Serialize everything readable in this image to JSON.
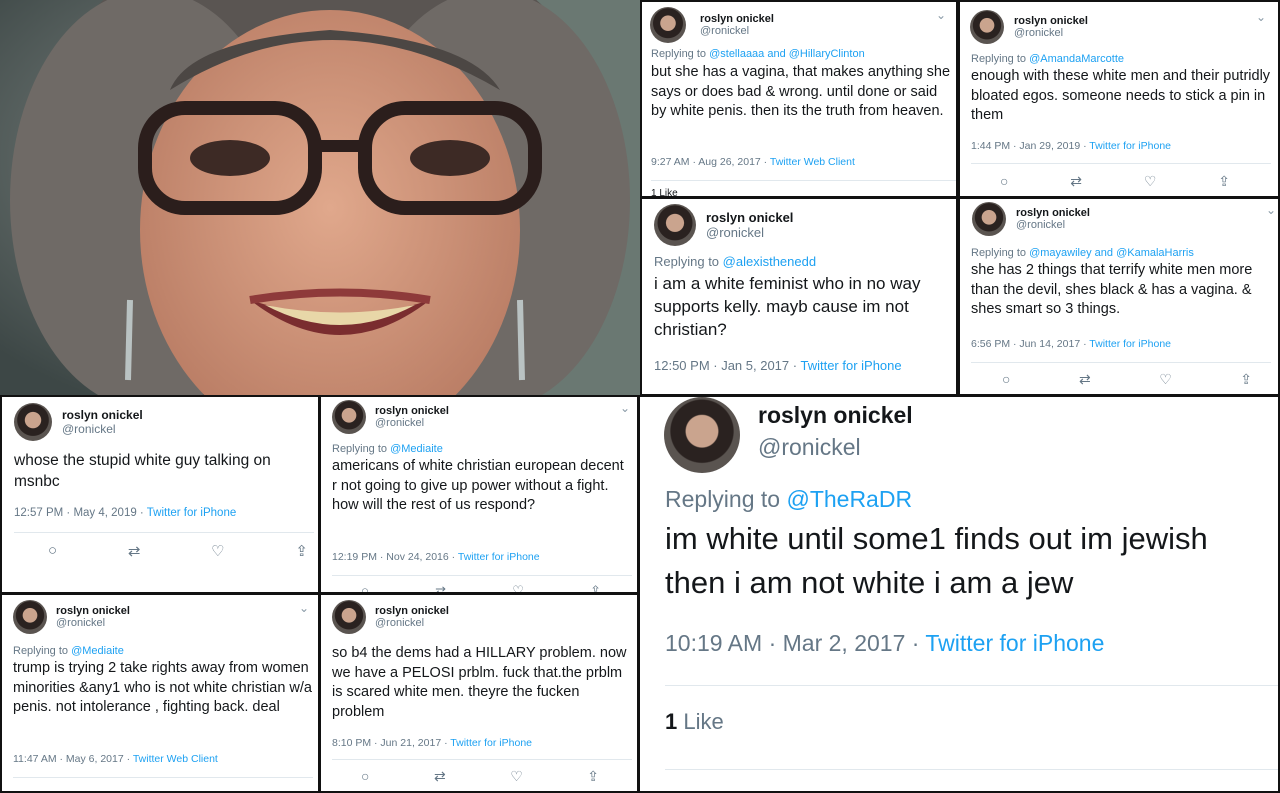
{
  "colors": {
    "link": "#1da1f2",
    "muted": "#657786",
    "text": "#14171a"
  },
  "user": {
    "name": "roslyn onickel",
    "handle": "@ronickel"
  },
  "tweets": [
    {
      "reply_prefix": "Replying to ",
      "reply_to": "@stellaaaa and @HillaryClinton",
      "text": "but she has a vagina, that makes anything she says or does bad & wrong. until done or said by white penis. then its the truth from heaven.",
      "time": "9:27 AM · Aug 26, 2017 · ",
      "source": "Twitter Web Client",
      "likes_partial": "1 Like"
    },
    {
      "reply_prefix": "Replying to ",
      "reply_to": "@AmandaMarcotte",
      "text": "enough with these white men and their putridly bloated egos. someone needs to stick a pin in them",
      "time": "1:44 PM · Jan 29, 2019 · ",
      "source": "Twitter for iPhone"
    },
    {
      "reply_prefix": "Replying to ",
      "reply_to": "@alexisthenedd",
      "text": "i am a white feminist who in no way supports kelly. mayb cause im not christian?",
      "time": "12:50 PM · Jan 5, 2017 · ",
      "source": "Twitter for iPhone"
    },
    {
      "reply_prefix": "Replying to ",
      "reply_to": "@mayawiley and @KamalaHarris",
      "text": "she has 2 things that terrify white men more than the devil, shes black & has a vagina. & shes smart so 3 things.",
      "time": "6:56 PM · Jun 14, 2017 · ",
      "source": "Twitter for iPhone"
    },
    {
      "text": "whose the stupid white guy talking on msnbc",
      "time": "12:57 PM · May 4, 2019 · ",
      "source": "Twitter for iPhone"
    },
    {
      "reply_prefix": "Replying to ",
      "reply_to": "@Mediaite",
      "text": "americans of white christian european decent r not going to give up power without a fight. how will the rest of us respond?",
      "time": "12:19 PM · Nov 24, 2016 · ",
      "source": "Twitter for iPhone"
    },
    {
      "reply_prefix": "Replying to ",
      "reply_to": "@TheRaDR",
      "text": "im white until some1 finds out im jewish then i am not white i am a jew",
      "time": "10:19 AM · Mar 2, 2017 · ",
      "source": "Twitter for iPhone",
      "likes_count": "1",
      "likes_label": " Like"
    },
    {
      "reply_prefix": "Replying to ",
      "reply_to": "@Mediaite",
      "text": "trump is trying 2 take rights away from women minorities &any1 who is not white christian w/a penis. not intolerance , fighting back. deal",
      "time": "11:47 AM · May 6, 2017 · ",
      "source": "Twitter Web Client"
    },
    {
      "text": "so b4 the dems had a HILLARY problem. now we have a PELOSI prblm. fuck that.the prblm is scared white men. theyre the fucken problem",
      "time": "8:10 PM · Jun 21, 2017 · ",
      "source": "Twitter for iPhone"
    }
  ],
  "icons": {
    "reply": "comment-icon",
    "retweet": "retweet-icon",
    "like": "heart-icon",
    "share": "share-icon",
    "more": "chevron-down-icon"
  }
}
